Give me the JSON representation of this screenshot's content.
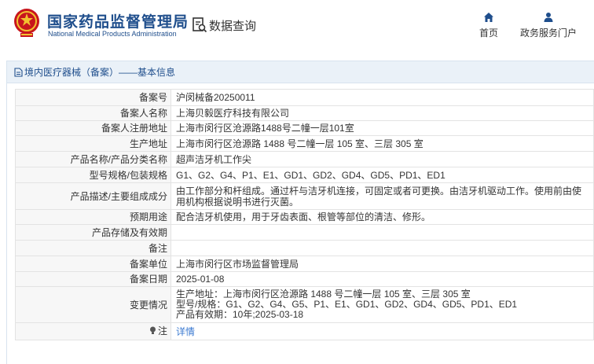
{
  "header": {
    "brand_title": "国家药品监督管理局",
    "brand_subtitle": "National Medical Products Administration",
    "search_label": "数据查询",
    "nav": [
      {
        "label": "首页",
        "icon": "home-icon"
      },
      {
        "label": "政务服务门户",
        "icon": "user-icon"
      }
    ],
    "brand_color": "#1f4e8c",
    "logo_color": "#c8161d"
  },
  "panel": {
    "title": "境内医疗器械（备案）——基本信息"
  },
  "rows": [
    {
      "label": "备案号",
      "value": "沪闵械备20250011"
    },
    {
      "label": "备案人名称",
      "value": "上海贝毅医疗科技有限公司"
    },
    {
      "label": "备案人注册地址",
      "value": "上海市闵行区沧源路1488号二幢一层101室"
    },
    {
      "label": "生产地址",
      "value": "上海市闵行区沧源路 1488 号二幢一层 105 室、三层 305 室"
    },
    {
      "label": "产品名称/产品分类名称",
      "value": "超声洁牙机工作尖"
    },
    {
      "label": "型号规格/包装规格",
      "value": "G1、G2、G4、P1、E1、GD1、GD2、GD4、GD5、PD1、ED1"
    },
    {
      "label": "产品描述/主要组成成分",
      "value": "由工作部分和杆组成。通过杆与洁牙机连接，可固定或者可更换。由洁牙机驱动工作。使用前由使用机构根据说明书进行灭菌。"
    },
    {
      "label": "预期用途",
      "value": "配合洁牙机使用，用于牙齿表面、根管等部位的清洁、修形。"
    },
    {
      "label": "产品存储及有效期",
      "value": ""
    },
    {
      "label": "备注",
      "value": ""
    },
    {
      "label": "备案单位",
      "value": "上海市闵行区市场监督管理局"
    },
    {
      "label": "备案日期",
      "value": "2025-01-08"
    }
  ],
  "change": {
    "label": "变更情况",
    "lines": [
      "生产地址：上海市闵行区沧源路 1488 号二幢一层 105 室、三层 305 室",
      "型号/规格：G1、G2、G4、G5、P1、E1、GD1、GD2、GD4、GD5、PD1、ED1",
      "产品有效期：10年;2025-03-18"
    ]
  },
  "note": {
    "label": "注",
    "icon": "lightbulb-icon",
    "link": "详情"
  }
}
